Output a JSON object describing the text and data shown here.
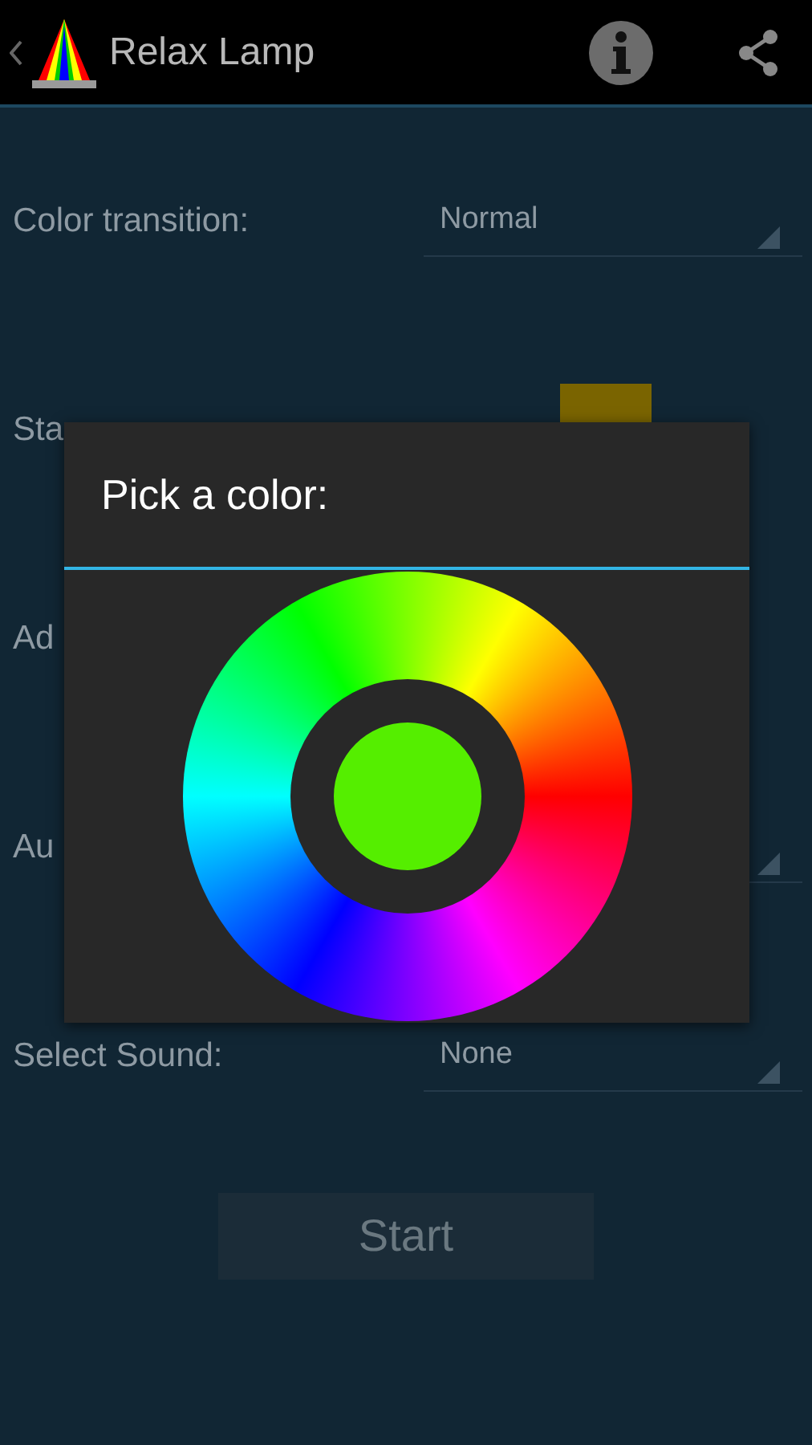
{
  "action_bar": {
    "title": "Relax Lamp"
  },
  "settings": [
    {
      "kind": "spinner",
      "label": "Color transition:",
      "value": "Normal"
    },
    {
      "kind": "color",
      "label": "Sta",
      "color": "#7a6400"
    },
    {
      "kind": "plain",
      "label": "Ad"
    },
    {
      "kind": "spinner",
      "label": "Au"
    },
    {
      "kind": "spinner",
      "label": "Select Sound:",
      "value": "None"
    }
  ],
  "start_button": {
    "label": "Start",
    "disabled": true
  },
  "dialog": {
    "title": "Pick a color:",
    "color": "#55ee00"
  }
}
